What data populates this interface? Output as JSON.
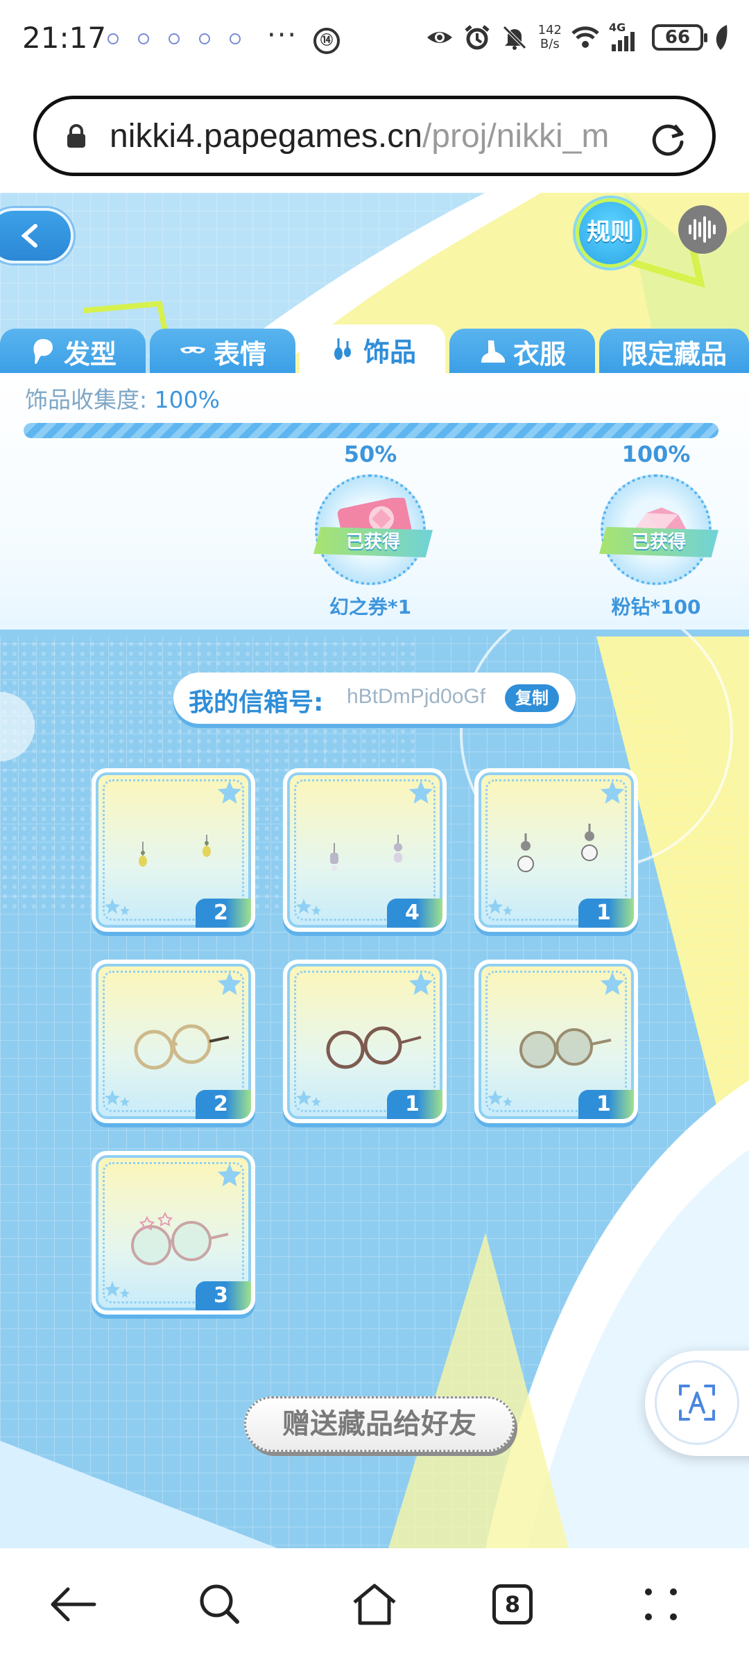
{
  "status_bar": {
    "time": "21:17",
    "net_speed_value": "142",
    "net_speed_unit": "B/s",
    "network_type": "4G",
    "battery": "66"
  },
  "browser": {
    "url_host": "nikki4.papegames.cn",
    "url_path": "/proj/nikki_m"
  },
  "header": {
    "rules_label": "规则"
  },
  "tabs": [
    {
      "label": "发型",
      "icon": "hair-icon"
    },
    {
      "label": "表情",
      "icon": "mask-icon"
    },
    {
      "label": "饰品",
      "icon": "earring-icon"
    },
    {
      "label": "衣服",
      "icon": "shoe-icon"
    },
    {
      "label": "限定藏品",
      "icon": ""
    }
  ],
  "collection": {
    "label": "饰品收集度:",
    "value": "100%",
    "progress_fraction": 1.0,
    "milestones": [
      {
        "percent": "50%",
        "status": "已获得",
        "reward": "幻之券*1"
      },
      {
        "percent": "100%",
        "status": "已获得",
        "reward": "粉钻*100"
      }
    ]
  },
  "mailbox": {
    "label": "我的信箱号:",
    "value": "hBtDmPjd0oGf",
    "copy_label": "复制"
  },
  "items": [
    {
      "kind": "earrings-yellow",
      "count": "2"
    },
    {
      "kind": "earrings-charm",
      "count": "4"
    },
    {
      "kind": "earrings-pearl",
      "count": "1"
    },
    {
      "kind": "glasses-gold",
      "count": "2"
    },
    {
      "kind": "glasses-brown",
      "count": "1"
    },
    {
      "kind": "glasses-tinted",
      "count": "1"
    },
    {
      "kind": "glasses-star",
      "count": "3"
    }
  ],
  "gift_button": "赠送藏品给好友",
  "bottom_nav": {
    "tab_count": "8"
  },
  "colors": {
    "accent": "#2f8ed8",
    "tab_bg": "#3a9ee6",
    "panel_bg": "#8ccbef",
    "highlight_yellow": "#f7f27a"
  }
}
